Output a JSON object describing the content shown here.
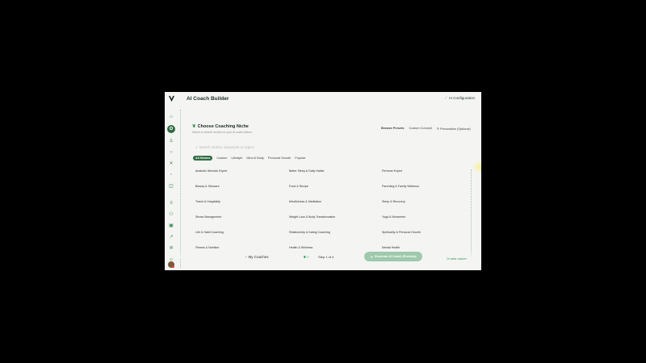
{
  "header": {
    "app_title": "AI Coach Builder",
    "ai_config_label": "AI Configuration"
  },
  "sidebar": {
    "icons": [
      "home-icon",
      "coach-icon",
      "user-icon",
      "chat-icon",
      "puzzle-icon",
      "chart-icon",
      "calendar-icon",
      "list-icon",
      "group-icon",
      "calendar2-icon",
      "trend-icon",
      "settings-icon",
      "person-icon"
    ]
  },
  "page": {
    "title": "Choose Coaching Niche",
    "subtitle": "Select or search niches for your AI coach below",
    "links": {
      "browse": "Browse Presets",
      "custom": "Custom Concept",
      "personalize": "Personalize (Optional)"
    },
    "search_placeholder": "Search niches, keywords or topics"
  },
  "tabs": [
    "All Niches",
    "Custom",
    "Lifestyle",
    "Mind & Body",
    "Personal Growth",
    "Popular"
  ],
  "niches": [
    [
      "Anabolic Steroids Expert",
      "Better Sleep & Daily Habits",
      "Perfume Expert"
    ],
    [
      "Beauty & Skincare",
      "Food & Recipe",
      "Parenting & Family Wellness"
    ],
    [
      "Travel & Hospitality",
      "Mindfulness & Meditation",
      "Sleep & Recovery"
    ],
    [
      "Stress Management",
      "Weight Loss & Body Transformation",
      "Yoga & Movement"
    ],
    [
      "Life & Habit Coaching",
      "Relationship & Dating Coaching",
      "Spirituality & Personal Growth"
    ],
    [
      "Fitness & Nutrition",
      "Health & Wellness",
      "Mental Health"
    ]
  ],
  "footer": {
    "my_coaches": "My Coaches",
    "progress": 0.25,
    "step": "Step 1 of 4",
    "generate": "Generate AI Coach (Preview)",
    "write_custom": "Or write custom"
  },
  "colors": {
    "accent": "#2f6b43",
    "accent_light": "#9fc9ac",
    "background": "#f4f5f2"
  }
}
